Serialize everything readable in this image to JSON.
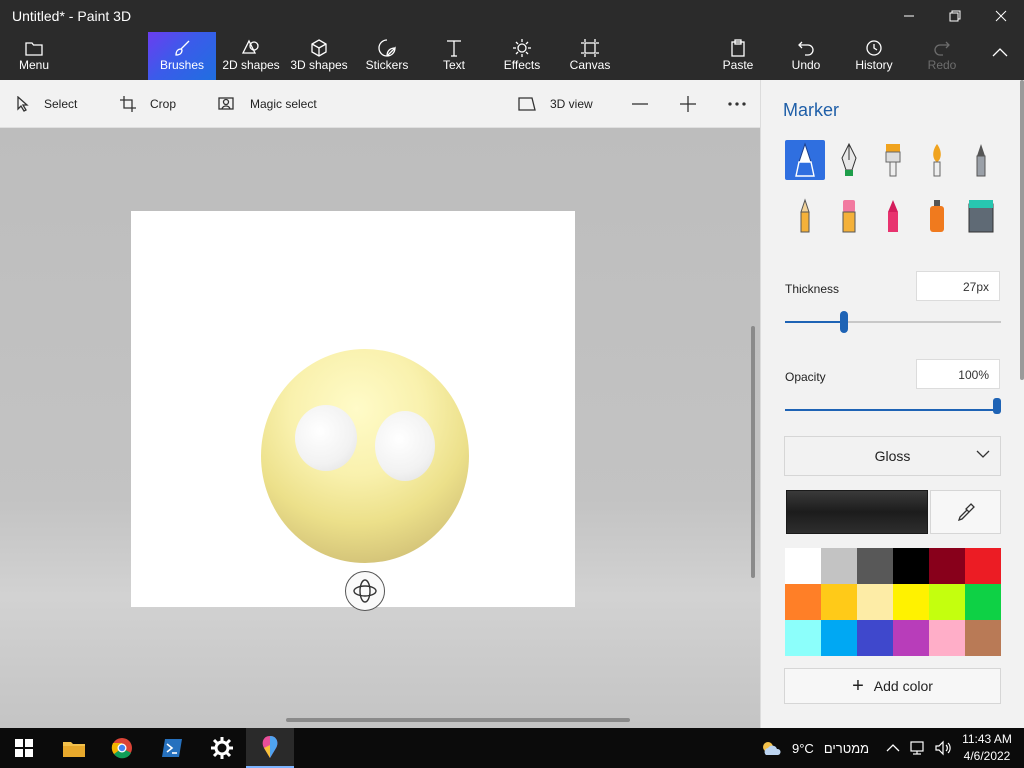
{
  "window": {
    "title": "Untitled* - Paint 3D"
  },
  "ribbon": {
    "menu": "Menu",
    "brushes": "Brushes",
    "shapes2d": "2D shapes",
    "shapes3d": "3D shapes",
    "stickers": "Stickers",
    "text": "Text",
    "effects": "Effects",
    "canvas": "Canvas",
    "paste": "Paste",
    "undo": "Undo",
    "history": "History",
    "redo": "Redo",
    "active_color": "#3b5bea"
  },
  "toolbar": {
    "select": "Select",
    "crop": "Crop",
    "magic_select": "Magic select",
    "view3d": "3D view"
  },
  "panel": {
    "title": "Marker",
    "brushes": [
      "marker-icon",
      "calligraphy-pen-icon",
      "oil-brush-icon",
      "watercolor-icon",
      "pixel-pen-icon",
      "pencil-icon",
      "eraser-icon",
      "crayon-icon",
      "spray-can-icon",
      "fill-bucket-icon"
    ],
    "thickness_label": "Thickness",
    "thickness_value": "27px",
    "thickness_level": 0.27,
    "opacity_label": "Opacity",
    "opacity_value": "100%",
    "opacity_level": 1.0,
    "finish": "Gloss",
    "current_color": "#222222",
    "palette": [
      "#ffffff",
      "#c3c3c3",
      "#585858",
      "#000000",
      "#88001b",
      "#ec1c24",
      "#ff7f27",
      "#ffca18",
      "#fdeca6",
      "#fff200",
      "#c4ff0e",
      "#0ed145",
      "#8cfffb",
      "#00a8f3",
      "#3f48cc",
      "#b83dba",
      "#ffaec8",
      "#b97a56"
    ],
    "add_color": "Add color"
  },
  "taskbar": {
    "weather": "9°C",
    "weather_text": "ממטרים",
    "time": "11:43 AM",
    "date": "4/6/2022"
  }
}
